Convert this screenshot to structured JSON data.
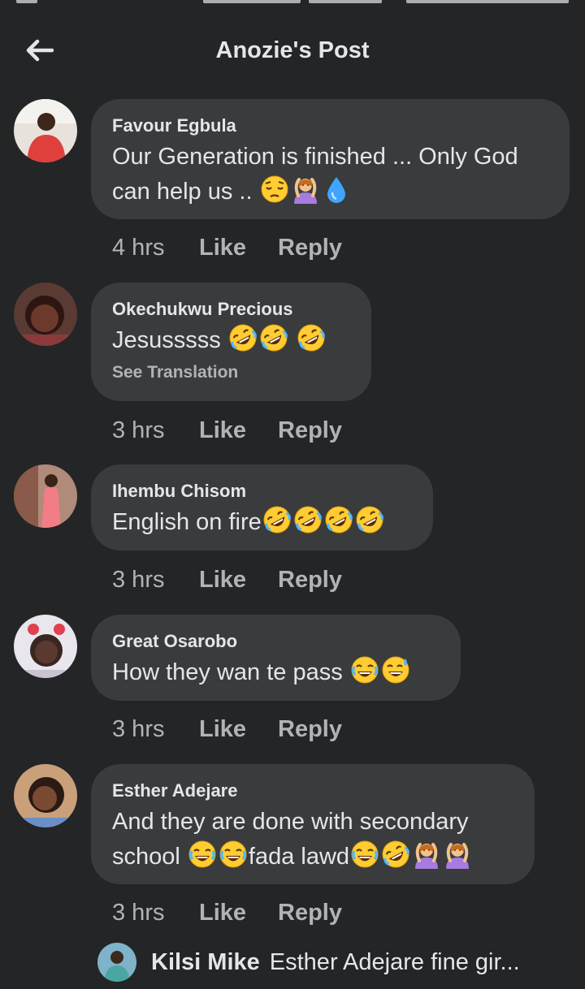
{
  "header": {
    "title": "Anozie's Post"
  },
  "comments": [
    {
      "author": "Favour Egbula",
      "text_line1": "Our Generation is finished ... Only God",
      "text_line2": "can help us ..",
      "time": "4 hrs",
      "like": "Like",
      "reply": "Reply",
      "emojis": [
        "pensive-face",
        "person-gesturing-ok",
        "droplet"
      ]
    },
    {
      "author": "Okechukwu Precious",
      "text": "Jesusssss",
      "see_translation": "See Translation",
      "time": "3 hrs",
      "like": "Like",
      "reply": "Reply",
      "emojis": [
        "rolling-laughing",
        "rolling-laughing",
        "rolling-laughing"
      ]
    },
    {
      "author": "Ihembu Chisom",
      "text": "English on fire",
      "time": "3 hrs",
      "like": "Like",
      "reply": "Reply",
      "emojis": [
        "rolling-laughing",
        "rolling-laughing",
        "rolling-laughing",
        "rolling-laughing"
      ]
    },
    {
      "author": "Great Osarobo",
      "text": "How they wan te pass",
      "time": "3 hrs",
      "like": "Like",
      "reply": "Reply",
      "emojis": [
        "tears-of-joy",
        "grinning-sweat"
      ]
    },
    {
      "author": "Esther Adejare",
      "text_line1": "And they are done with secondary",
      "text_line2_a": "school",
      "text_line2_b": "fada lawd",
      "time": "3 hrs",
      "like": "Like",
      "reply": "Reply",
      "emojis": [
        "tears-of-joy",
        "tears-of-joy",
        "tears-of-joy",
        "rolling-laughing",
        "person-gesturing-ok",
        "person-gesturing-ok"
      ]
    }
  ],
  "reply_preview": {
    "author": "Kilsi Mike",
    "text": "Esther Adejare fine gir..."
  },
  "colors": {
    "background": "#242526",
    "bubble": "#3a3b3c",
    "primary_text": "#e4e6eb",
    "secondary_text": "#b0b3b8"
  }
}
